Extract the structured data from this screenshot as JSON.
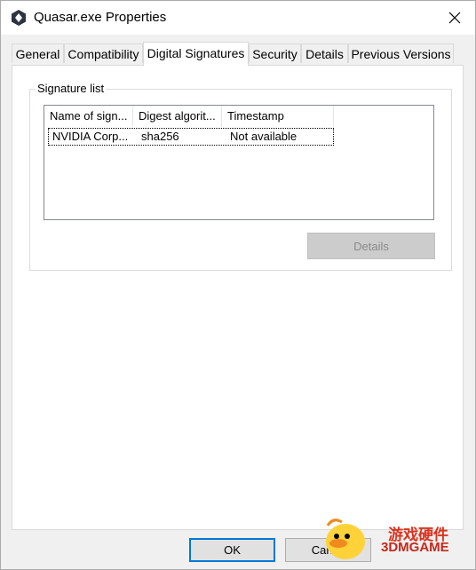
{
  "window": {
    "title": "Quasar.exe Properties"
  },
  "tabs": [
    {
      "label": "General"
    },
    {
      "label": "Compatibility"
    },
    {
      "label": "Digital Signatures"
    },
    {
      "label": "Security"
    },
    {
      "label": "Details"
    },
    {
      "label": "Previous Versions"
    }
  ],
  "active_tab": "Digital Signatures",
  "signature_list": {
    "label": "Signature list",
    "columns": [
      "Name of sign...",
      "Digest algorit...",
      "Timestamp"
    ],
    "rows": [
      {
        "name": "NVIDIA Corp...",
        "digest": "sha256",
        "timestamp": "Not available"
      }
    ]
  },
  "buttons": {
    "details": "Details",
    "ok": "OK",
    "cancel": "Cance"
  },
  "watermark": {
    "text": "游戏硬件",
    "brand": "3DMGAME"
  },
  "colors": {
    "focus_border": "#0078d7",
    "disabled_text": "#8a8a8a"
  }
}
